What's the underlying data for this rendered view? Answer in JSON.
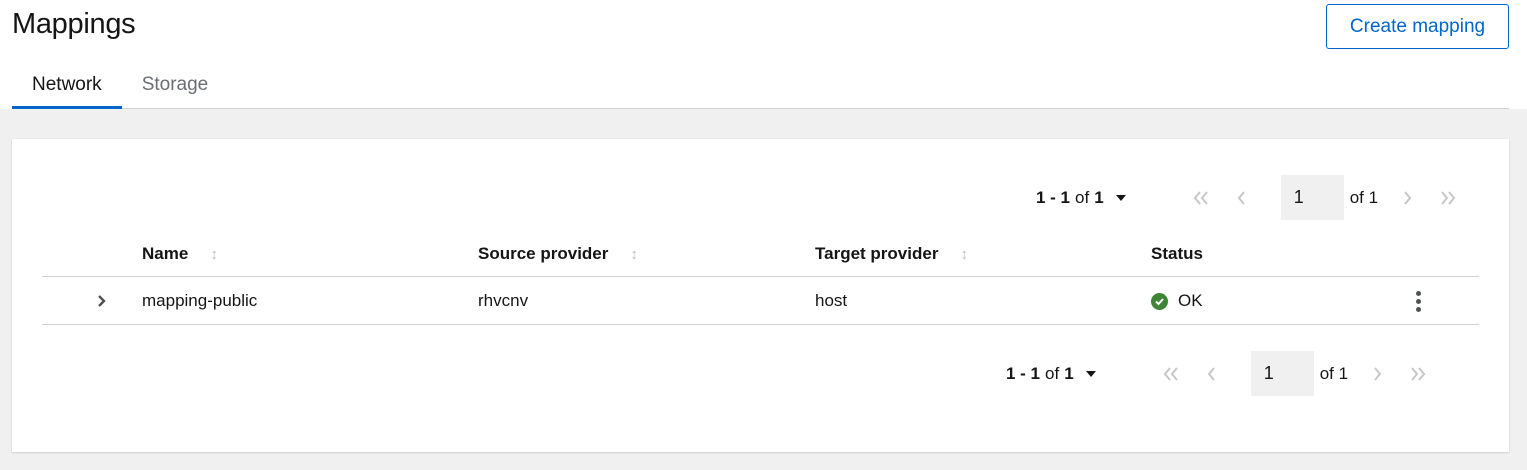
{
  "header": {
    "title": "Mappings",
    "create_label": "Create mapping"
  },
  "tabs": [
    {
      "label": "Network",
      "active": true
    },
    {
      "label": "Storage",
      "active": false
    }
  ],
  "pagination_top": {
    "range_start": "1 - 1",
    "range_of": "of",
    "range_total": "1",
    "page": "1",
    "of_pages": "of 1"
  },
  "pagination_bottom": {
    "range_start": "1 - 1",
    "range_of": "of",
    "range_total": "1",
    "page": "1",
    "of_pages": "of 1"
  },
  "table": {
    "columns": [
      "Name",
      "Source provider",
      "Target provider",
      "Status"
    ],
    "rows": [
      {
        "name": "mapping-public",
        "source": "rhvcnv",
        "target": "host",
        "status": "OK"
      }
    ]
  },
  "colors": {
    "accent": "#0066cc",
    "status_ok": "#3e8635",
    "background": "#f0f0f0"
  },
  "icons": {
    "sort": "sort-icon",
    "expand": "chevron-right-icon",
    "status_ok": "check-circle-icon",
    "row_actions": "kebab-icon",
    "toggle": "caret-down-icon",
    "first": "double-chevron-left-icon",
    "prev": "chevron-left-icon",
    "next": "chevron-right-icon",
    "last": "double-chevron-right-icon"
  }
}
